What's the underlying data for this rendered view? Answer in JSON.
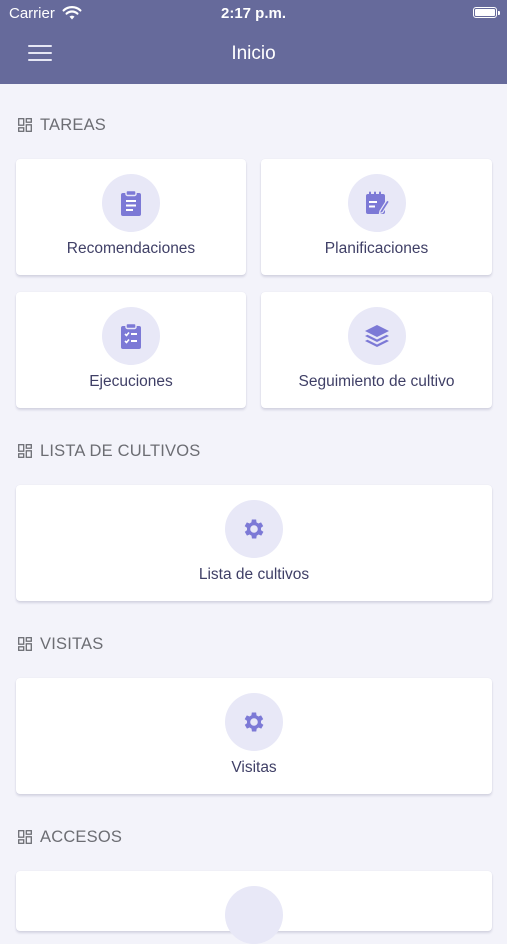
{
  "status_bar": {
    "carrier": "Carrier",
    "time": "2:17 p.m."
  },
  "header": {
    "title": "Inicio"
  },
  "sections": [
    {
      "title": "TAREAS",
      "cards": [
        "Recomendaciones",
        "Planificaciones",
        "Ejecuciones",
        "Seguimiento de cultivo"
      ]
    },
    {
      "title": "LISTA DE CULTIVOS",
      "cards": [
        "Lista de cultivos"
      ]
    },
    {
      "title": "VISITAS",
      "cards": [
        "Visitas"
      ]
    },
    {
      "title": "ACCESOS",
      "cards": []
    }
  ],
  "colors": {
    "header": "#666a9b",
    "icon": "#7c79d6",
    "icon_bg": "#e8e8f7",
    "label": "#3f3f66"
  }
}
